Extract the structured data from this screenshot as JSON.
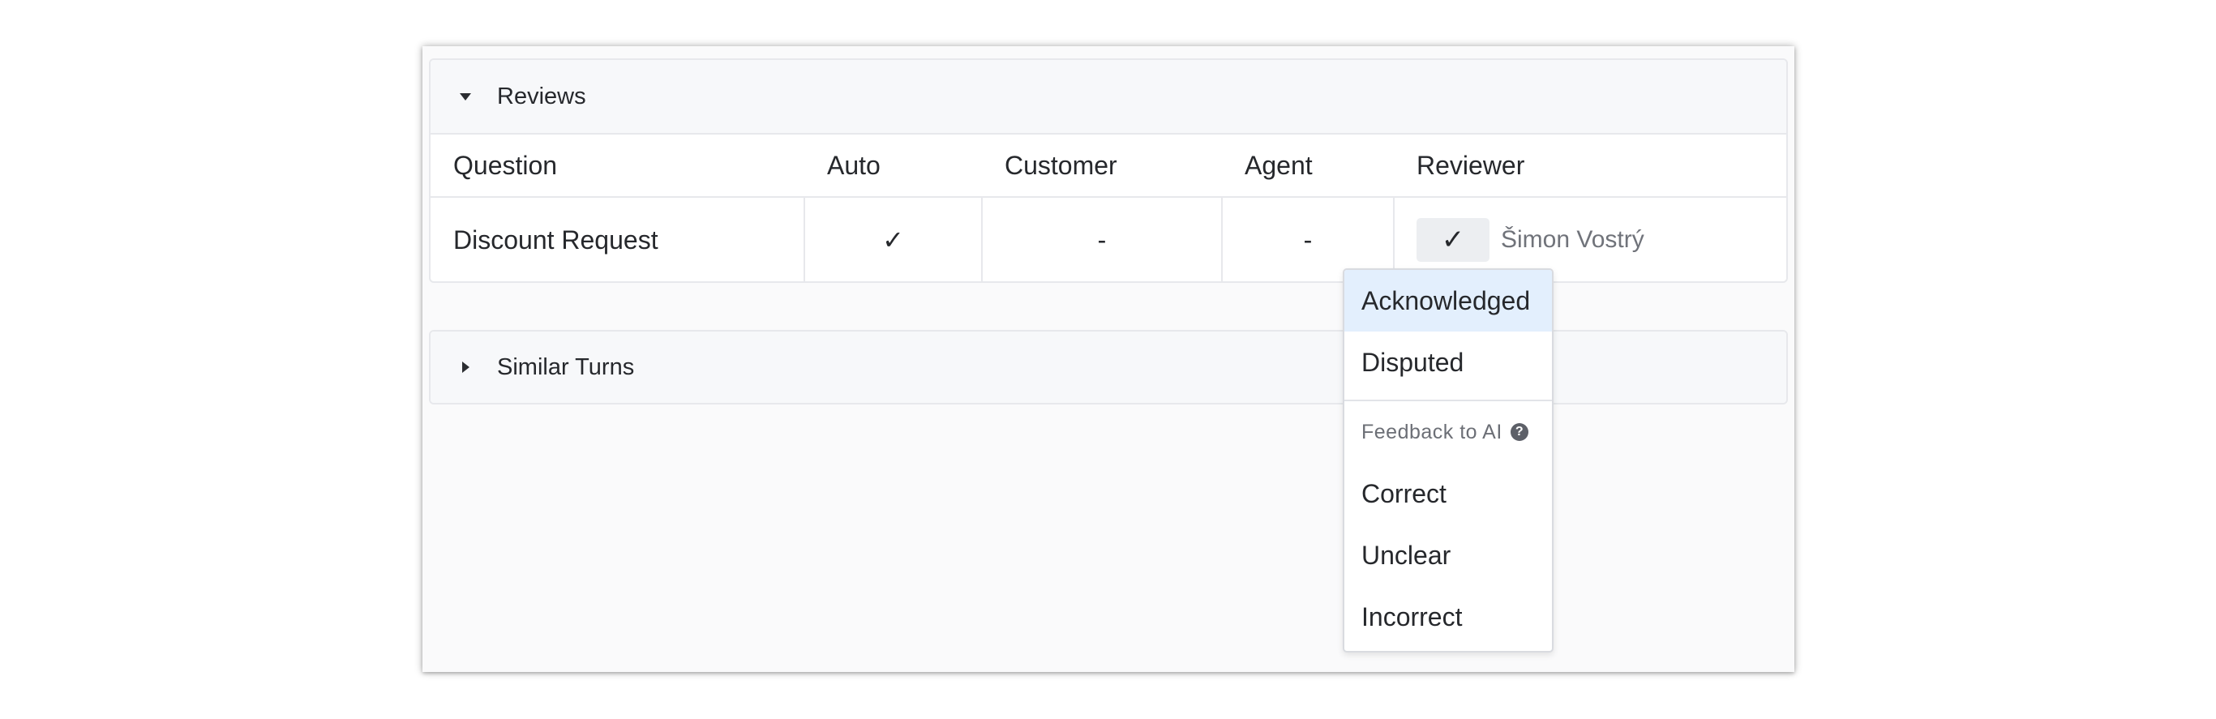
{
  "reviews_panel": {
    "title": "Reviews"
  },
  "table": {
    "headers": {
      "question": "Question",
      "auto": "Auto",
      "customer": "Customer",
      "agent": "Agent",
      "reviewer": "Reviewer"
    },
    "rows": [
      {
        "question": "Discount Request",
        "auto": "✓",
        "customer": "-",
        "agent": "-",
        "reviewer_check": "✓",
        "reviewer_name": "Šimon Vostrý"
      }
    ]
  },
  "similar_panel": {
    "title": "Similar Turns"
  },
  "dropdown": {
    "items": [
      "Acknowledged",
      "Disputed"
    ],
    "active_index": 0,
    "group_label": "Feedback to AI",
    "help_icon": "?",
    "feedback_items": [
      "Correct",
      "Unclear",
      "Incorrect"
    ]
  }
}
